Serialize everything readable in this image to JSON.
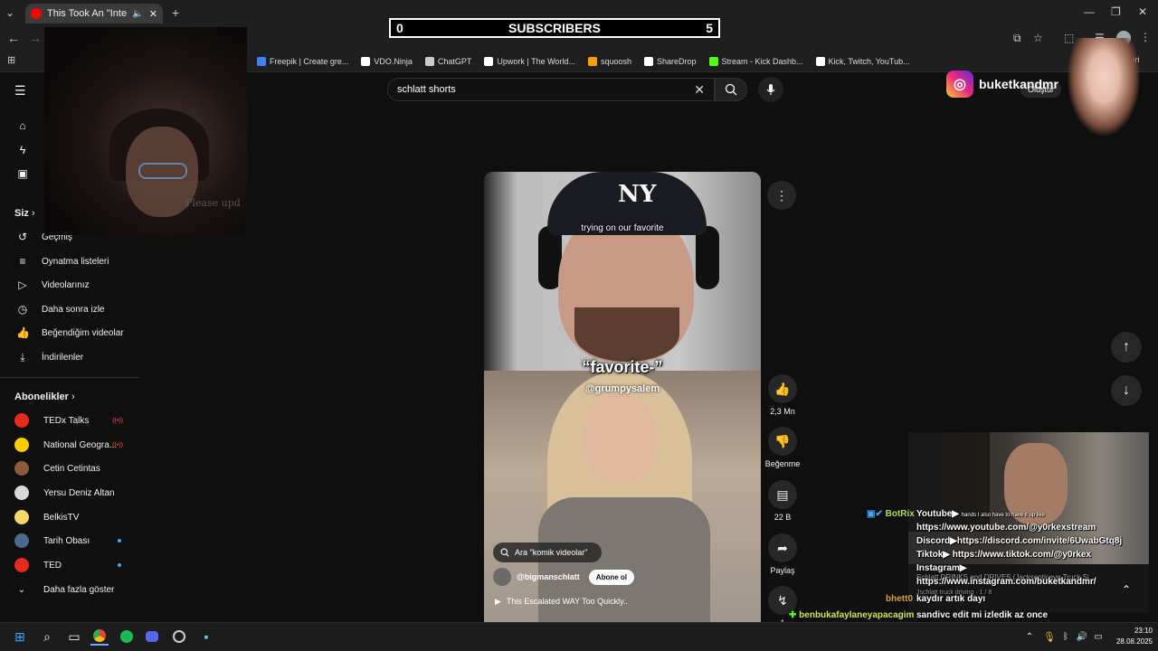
{
  "browser": {
    "tab_title": "This Took An \"Interesting\" T",
    "bookmarks": [
      {
        "label": "Freepik | Create gre...",
        "color": "#3b82f6"
      },
      {
        "label": "VDO.Ninja",
        "color": "#ffffff"
      },
      {
        "label": "ChatGPT",
        "color": "#cccccc"
      },
      {
        "label": "Upwork | The World...",
        "color": "#ffffff"
      },
      {
        "label": "squoosh",
        "color": "#f59e0b"
      },
      {
        "label": "ShareDrop",
        "color": "#ffffff"
      },
      {
        "label": "Stream - Kick Dashb...",
        "color": "#53fc18"
      },
      {
        "label": "Kick, Twitch, YouTub...",
        "color": "#ffffff"
      }
    ],
    "bookmark_overflow": "etleri"
  },
  "overlay": {
    "subs_left": "0",
    "subs_label": "SUBSCRIBERS",
    "subs_right": "5",
    "instagram_handle": "buketkandmr",
    "webcam_text": "Please upd"
  },
  "search": {
    "query": "schlatt  shorts"
  },
  "header": {
    "create_label": "Oluştur"
  },
  "sidebar": {
    "you_label": "Siz",
    "you_items": [
      {
        "label": "Geçmiş",
        "icon": "history-icon"
      },
      {
        "label": "Oynatma listeleri",
        "icon": "playlist-icon"
      },
      {
        "label": "Videolarınız",
        "icon": "your-videos-icon"
      },
      {
        "label": "Daha sonra izle",
        "icon": "watch-later-icon"
      },
      {
        "label": "Beğendiğim videolar",
        "icon": "like-icon"
      },
      {
        "label": "İndirilenler",
        "icon": "download-icon"
      }
    ],
    "subs_label": "Abonelikler",
    "subscriptions": [
      {
        "label": "TEDx Talks",
        "color": "#e62b1e",
        "live": true,
        "dot": false
      },
      {
        "label": "National Geogra...",
        "color": "#ffcc00",
        "live": true,
        "dot": false
      },
      {
        "label": "Cetin Cetintas",
        "color": "#8b5a3c",
        "live": false,
        "dot": false
      },
      {
        "label": "Yersu Deniz Altan",
        "color": "#d9d9d9",
        "live": false,
        "dot": false
      },
      {
        "label": "BelkisTV",
        "color": "#f5d76e",
        "live": false,
        "dot": false
      },
      {
        "label": "Tarih Obası",
        "color": "#4a6a8a",
        "live": false,
        "dot": true
      },
      {
        "label": "TED",
        "color": "#e62b1e",
        "live": false,
        "dot": true
      }
    ],
    "show_more": "Daha fazla göster",
    "live_badge": "((•))"
  },
  "short": {
    "caption_top": "trying on our favorite",
    "caption_big": "“favorite-”",
    "caption_handle": "@grumpysalem",
    "search_chip": "Ara \"komik videolar\"",
    "channel": "@bigmanschlatt",
    "subscribe": "Abone ol",
    "title": "This Escalated WAY Too Quickly..",
    "cap_logo": "NY"
  },
  "actions": {
    "likes": "2,3 Mn",
    "dislike": "Beğenme",
    "comments": "22 B",
    "share": "Paylaş",
    "remix": "1"
  },
  "stream": {
    "lines": [
      {
        "text": "Youtube▶",
        "small": "hands I also have to have it up like"
      },
      {
        "text": "https://www.youtube.com/@y0rkexstream"
      },
      {
        "text": "Discord▶https://discord.com/invite/6UwabGtq8j"
      },
      {
        "text": "Tiktok▶ https://www.tiktok.com/@y0rkex"
      },
      {
        "text": "Instagram▶"
      },
      {
        "text": "https://www.instagram.com/buketkandmr/"
      }
    ],
    "botrix": "BotRix",
    "sub_caption": "Schlatt DRINKS and DRIVES (Jacksepticeye Truck Si...",
    "sub_caption2": "Jschlatt truck driving",
    "page": "1 / 8",
    "chat": [
      {
        "user": "bhett0",
        "msg": "kaydır artık dayı",
        "color": "#e2a23b"
      },
      {
        "user": "benbukafaylaneyapacagim",
        "msg": "sandivc edit mi izledik az once",
        "color": "#d8e84a"
      }
    ]
  },
  "clock": {
    "time": "23:10",
    "date": "28.08.2025"
  }
}
